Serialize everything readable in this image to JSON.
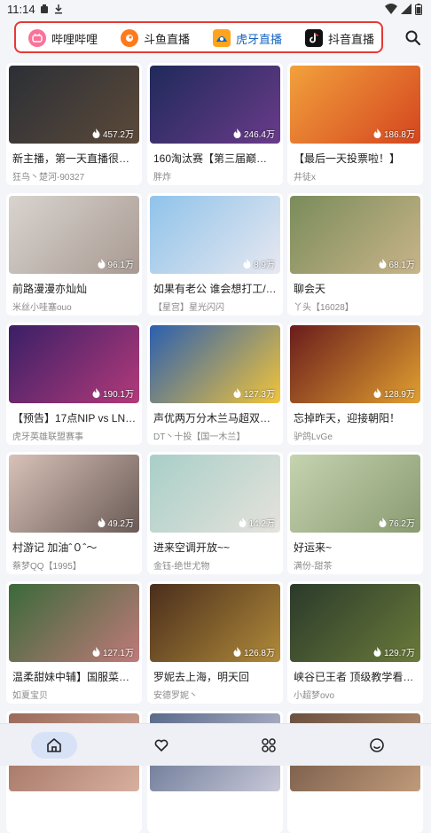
{
  "status_bar": {
    "time": "11:14"
  },
  "platforms": [
    {
      "label": "哔哩哔哩",
      "color": "#fb7299",
      "icon": "bilibili-logo-icon",
      "active": false
    },
    {
      "label": "斗鱼直播",
      "color": "#ff7a1a",
      "icon": "douyu-logo-icon",
      "active": false
    },
    {
      "label": "虎牙直播",
      "color": "#ffa41c",
      "icon": "huya-logo-icon",
      "active": true
    },
    {
      "label": "抖音直播",
      "color": "#111111",
      "icon": "douyin-logo-icon",
      "active": false
    }
  ],
  "cards": [
    {
      "title": "新主播，第一天直播很…",
      "author": "狂鸟丶楚河-90327",
      "views": "457.2万",
      "thumb": [
        "#2b2f36",
        "#5c4a3a"
      ]
    },
    {
      "title": "160淘汰赛【第三届巅峰…",
      "author": "胖炸",
      "views": "246.4万",
      "thumb": [
        "#1f2a5a",
        "#6a3b8a"
      ]
    },
    {
      "title": "【最后一天投票啦！】",
      "author": "井徒x",
      "views": "186.8万",
      "thumb": [
        "#f2a13c",
        "#d4451f"
      ]
    },
    {
      "title": "前路漫漫亦灿灿",
      "author": "米丝小哇塞ouo",
      "views": "96.1万",
      "thumb": [
        "#d9d4cf",
        "#a89a92"
      ]
    },
    {
      "title": "如果有老公 谁会想打工/…",
      "author": "【星宫】星光闪闪",
      "views": "8.9万",
      "thumb": [
        "#8fc3ea",
        "#e8e8f0"
      ]
    },
    {
      "title": "聊会天",
      "author": "丫头【16028】",
      "views": "68.1万",
      "thumb": [
        "#7a8c5a",
        "#c9b48a"
      ]
    },
    {
      "title": "【预告】17点NIP vs LN…",
      "author": "虎牙英雄联盟赛事",
      "views": "190.1万",
      "thumb": [
        "#3a1f66",
        "#b33a7a"
      ]
    },
    {
      "title": "声优两万分木兰马超双…",
      "author": "DT丶十投【国一木兰】",
      "views": "127.3万",
      "thumb": [
        "#2b5fb0",
        "#f2c43a"
      ]
    },
    {
      "title": "忘掉昨天，迎接朝阳！",
      "author": "驴鸽LvGe",
      "views": "128.9万",
      "thumb": [
        "#6a1c1c",
        "#e0a030"
      ]
    },
    {
      "title": "村游记 加油ˆ０ˆ～",
      "author": "蔡梦QQ【1995】",
      "views": "49.2万",
      "thumb": [
        "#d8c2b8",
        "#6a5a55"
      ]
    },
    {
      "title": "进来空调开放~~",
      "author": "金钰-绝世尤物",
      "views": "14.2万",
      "thumb": [
        "#a8cfc8",
        "#e6e2dc"
      ]
    },
    {
      "title": "好运来~",
      "author": "满份-甜茶",
      "views": "76.2万",
      "thumb": [
        "#c5d4b0",
        "#8a9a70"
      ]
    },
    {
      "title": "温柔甜妹中辅】国服菜…",
      "author": "如夏宝贝",
      "views": "127.1万",
      "thumb": [
        "#3a6a3a",
        "#c07a7a"
      ]
    },
    {
      "title": "罗妮去上海，明天回",
      "author": "安德罗妮丶",
      "views": "126.8万",
      "thumb": [
        "#4a2e1c",
        "#b08a3a"
      ]
    },
    {
      "title": "峡谷已王者 顶级教学看…",
      "author": "小超梦ovo",
      "views": "129.7万",
      "thumb": [
        "#2a3a2a",
        "#6a7a3a"
      ]
    },
    {
      "title": "",
      "author": "",
      "views": "",
      "thumb": [
        "#9a6a5a",
        "#d8b0a0"
      ]
    },
    {
      "title": "",
      "author": "",
      "views": "",
      "thumb": [
        "#5a6a8a",
        "#c8c8d8"
      ]
    },
    {
      "title": "",
      "author": "",
      "views": "",
      "thumb": [
        "#6a5040",
        "#c09a7a"
      ]
    }
  ],
  "bottom_nav": [
    {
      "icon": "home-icon",
      "active": true
    },
    {
      "icon": "heart-icon",
      "active": false
    },
    {
      "icon": "grid-icon",
      "active": false
    },
    {
      "icon": "smiley-icon",
      "active": false
    }
  ]
}
